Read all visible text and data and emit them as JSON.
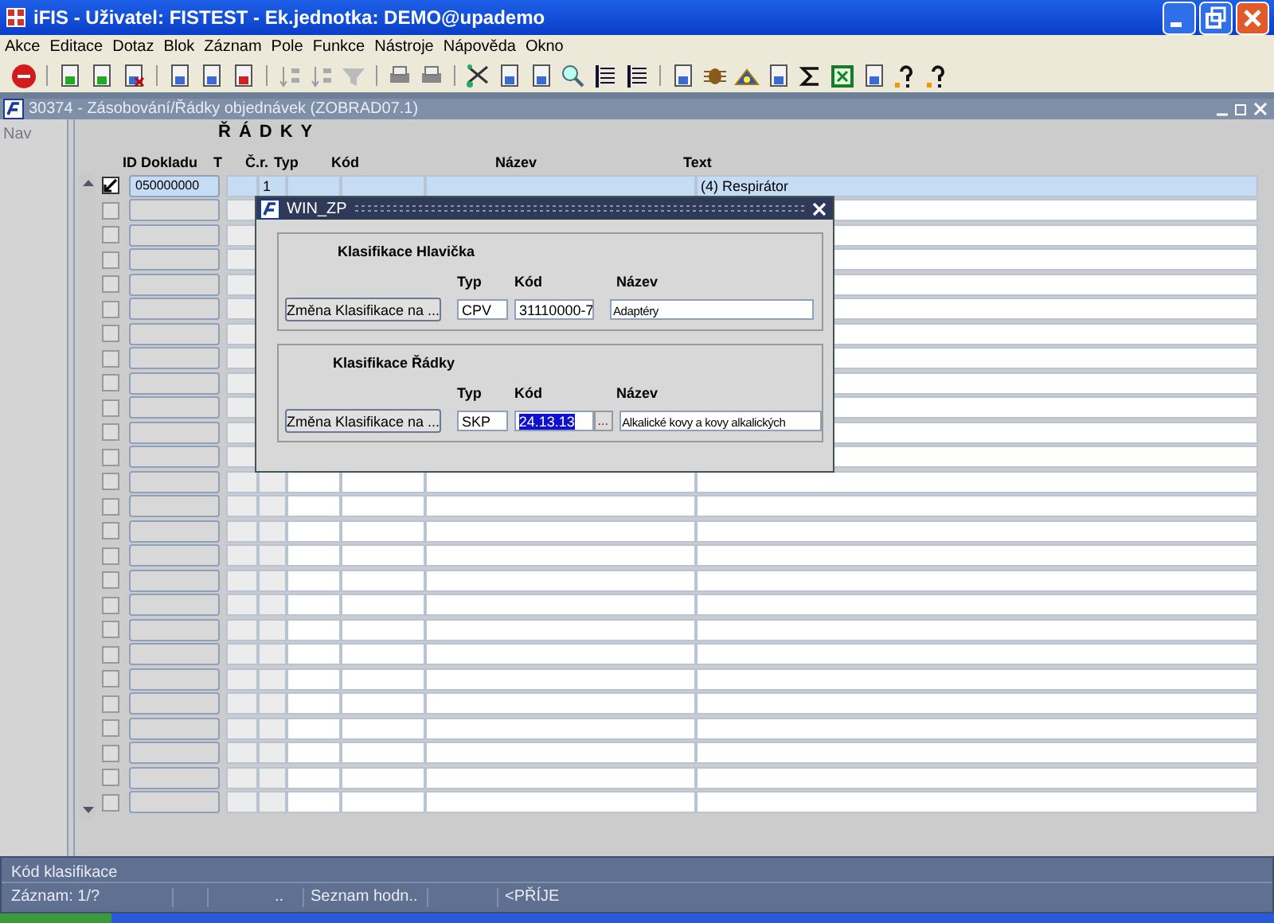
{
  "window": {
    "title": "iFIS - Uživatel: FISTEST - Ek.jednotka: DEMO@upademo"
  },
  "menu": [
    "Akce",
    "Editace",
    "Dotaz",
    "Blok",
    "Záznam",
    "Pole",
    "Funkce",
    "Nástroje",
    "Nápověda",
    "Okno"
  ],
  "form": {
    "title": "30374 - Zásobování/Řádky objednávek (ZOBRAD07.1)",
    "nav": "Nav",
    "block_title": "ŘÁDKY",
    "columns": [
      "ID Dokladu",
      "T",
      "Č.r.",
      "Typ",
      "Kód",
      "Název",
      "Text"
    ],
    "rows": [
      {
        "selected": true,
        "checked": true,
        "id_dokladu": "050000000",
        "c_r": "1",
        "text": "(4) Respirátor"
      },
      {
        "selected": false,
        "checked": false
      },
      {
        "selected": false,
        "checked": false
      },
      {
        "selected": false,
        "checked": false
      },
      {
        "selected": false,
        "checked": false
      },
      {
        "selected": false,
        "checked": false
      },
      {
        "selected": false,
        "checked": false
      },
      {
        "selected": false,
        "checked": false
      },
      {
        "selected": false,
        "checked": false
      },
      {
        "selected": false,
        "checked": false
      },
      {
        "selected": false,
        "checked": false
      },
      {
        "selected": false,
        "checked": false
      },
      {
        "selected": false,
        "checked": false
      },
      {
        "selected": false,
        "checked": false
      },
      {
        "selected": false,
        "checked": false
      },
      {
        "selected": false,
        "checked": false
      },
      {
        "selected": false,
        "checked": false
      },
      {
        "selected": false,
        "checked": false
      },
      {
        "selected": false,
        "checked": false
      },
      {
        "selected": false,
        "checked": false
      },
      {
        "selected": false,
        "checked": false
      },
      {
        "selected": false,
        "checked": false
      },
      {
        "selected": false,
        "checked": false
      },
      {
        "selected": false,
        "checked": false
      },
      {
        "selected": false,
        "checked": false
      },
      {
        "selected": false,
        "checked": false
      }
    ]
  },
  "dialog": {
    "title": "WIN_ZP",
    "groups": [
      {
        "heading": "Klasifikace Hlavička",
        "labels": [
          "Typ",
          "Kód",
          "Název"
        ],
        "button": "Změna Klasifikace na ...",
        "typ": "CPV",
        "kod": "31110000-7",
        "nazev": "Adaptéry",
        "kod_selected": false
      },
      {
        "heading": "Klasifikace Řádky",
        "labels": [
          "Typ",
          "Kód",
          "Název"
        ],
        "button": "Změna Klasifikace na ...",
        "typ": "SKP",
        "kod": "24.13.13",
        "nazev": "Alkalické kovy a kovy alkalických",
        "kod_selected": true,
        "lookup": "..."
      }
    ]
  },
  "status_bar": {
    "hint": "Kód klasifikace",
    "cells": [
      "Záznam: 1/?",
      "",
      "..",
      "Seznam hodn..",
      "",
      "<PŘÍJE"
    ]
  }
}
